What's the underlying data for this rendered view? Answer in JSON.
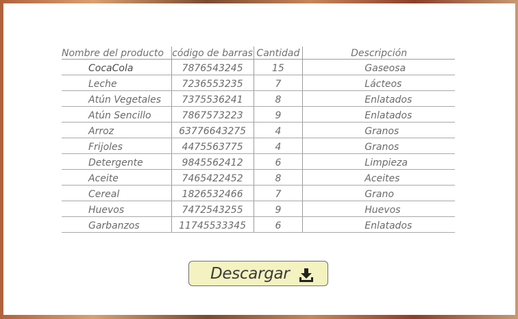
{
  "table": {
    "headers": [
      "Nombre del producto",
      "código de barras",
      "Cantidad",
      "Descripción"
    ],
    "rows": [
      {
        "name": "CocaCola",
        "code": "7876543245",
        "qty": "15",
        "desc": "Gaseosa"
      },
      {
        "name": "Leche",
        "code": "7236553235",
        "qty": "7",
        "desc": "Lácteos"
      },
      {
        "name": "Atún Vegetales",
        "code": "7375536241",
        "qty": "8",
        "desc": "Enlatados"
      },
      {
        "name": "Atún Sencillo",
        "code": "7867573223",
        "qty": "9",
        "desc": "Enlatados"
      },
      {
        "name": "Arroz",
        "code": "63776643275",
        "qty": "4",
        "desc": "Granos"
      },
      {
        "name": "Frijoles",
        "code": "4475563775",
        "qty": "4",
        "desc": "Granos"
      },
      {
        "name": "Detergente",
        "code": "9845562412",
        "qty": "6",
        "desc": "Limpieza"
      },
      {
        "name": "Aceite",
        "code": "7465422452",
        "qty": "8",
        "desc": "Aceites"
      },
      {
        "name": "Cereal",
        "code": "1826532466",
        "qty": "7",
        "desc": "Grano"
      },
      {
        "name": "Huevos",
        "code": "7472543255",
        "qty": "9",
        "desc": "Huevos"
      },
      {
        "name": "Garbanzos",
        "code": "11745533345",
        "qty": "6",
        "desc": "Enlatados"
      }
    ]
  },
  "download": {
    "label": "Descargar",
    "icon": "download-icon"
  },
  "colors": {
    "button_bg": "#f4f2c0",
    "button_border": "#6f6f6f",
    "text": "#6a6a6a"
  }
}
